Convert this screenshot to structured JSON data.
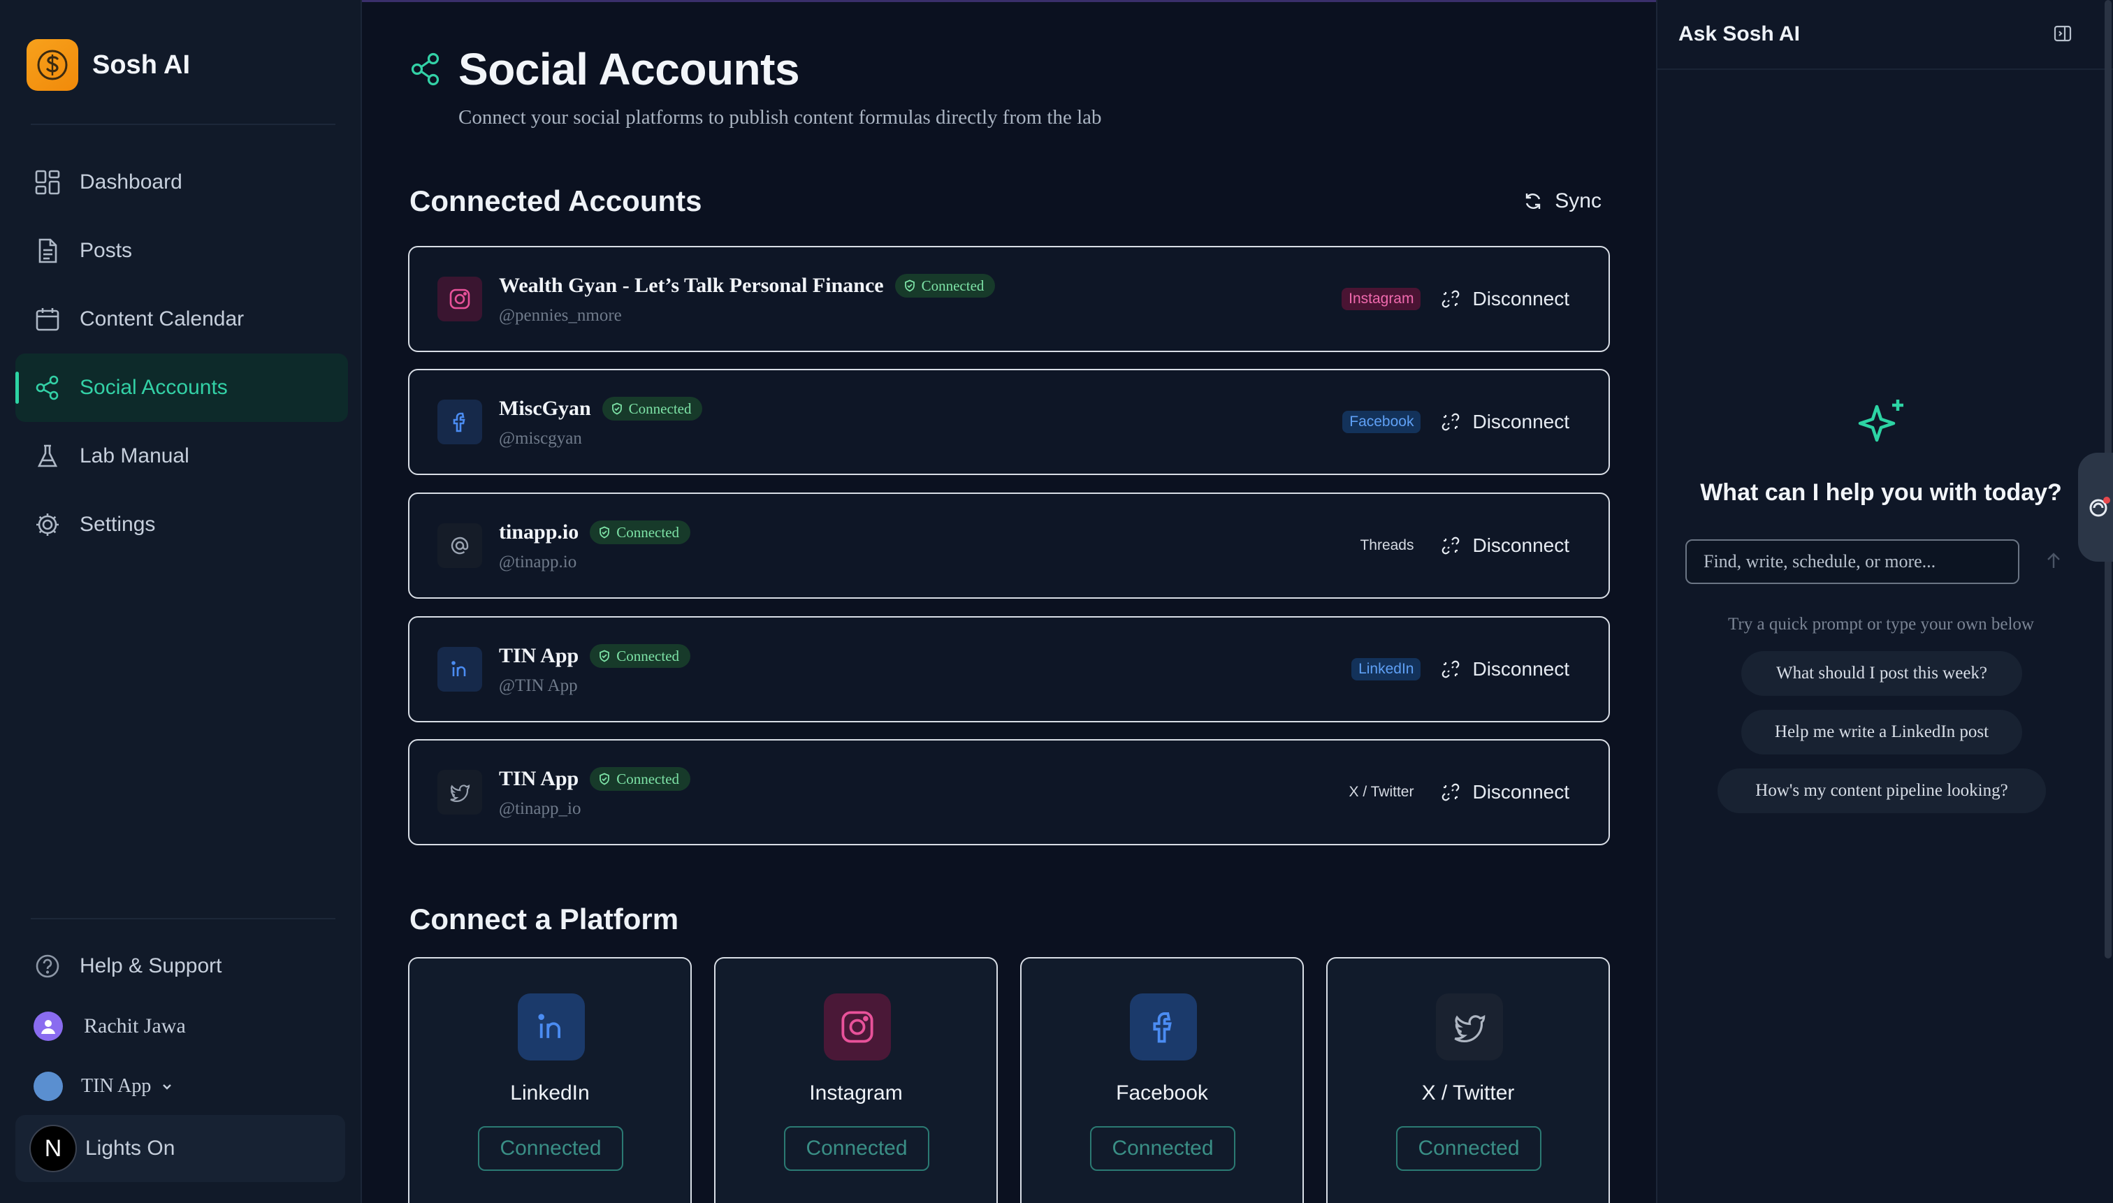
{
  "app": {
    "name": "Sosh AI"
  },
  "sidebar": {
    "items": [
      {
        "label": "Dashboard",
        "icon": "dashboard-icon"
      },
      {
        "label": "Posts",
        "icon": "document-icon"
      },
      {
        "label": "Content Calendar",
        "icon": "calendar-icon"
      },
      {
        "label": "Social Accounts",
        "icon": "share-icon",
        "active": true
      },
      {
        "label": "Lab Manual",
        "icon": "flask-icon"
      },
      {
        "label": "Settings",
        "icon": "gear-icon"
      }
    ],
    "help": "Help & Support",
    "user": "Rachit Jawa",
    "org": "TIN App",
    "lights": "Lights On",
    "n_badge": "N"
  },
  "page": {
    "title": "Social Accounts",
    "subtitle": "Connect your social platforms to publish content formulas directly from the lab"
  },
  "connected": {
    "title": "Connected Accounts",
    "sync_label": "Sync",
    "badge_label": "Connected",
    "disconnect_label": "Disconnect",
    "accounts": [
      {
        "name": "Wealth Gyan - Let’s Talk Personal Finance",
        "handle": "@pennies_nmore",
        "platform": "Instagram",
        "icon": "instagram-icon",
        "color": "#e8529a"
      },
      {
        "name": "MiscGyan",
        "handle": "@miscgyan",
        "platform": "Facebook",
        "icon": "facebook-icon",
        "color": "#3b82f6"
      },
      {
        "name": "tinapp.io",
        "handle": "@tinapp.io",
        "platform": "Threads",
        "icon": "threads-icon",
        "color": "#9aa3b1"
      },
      {
        "name": "TIN App",
        "handle": "@TIN App",
        "platform": "LinkedIn",
        "icon": "linkedin-icon",
        "color": "#3b82f6"
      },
      {
        "name": "TIN App",
        "handle": "@tinapp_io",
        "platform": "X / Twitter",
        "icon": "twitter-icon",
        "color": "#9aa3b1"
      }
    ]
  },
  "connect": {
    "title": "Connect a Platform",
    "platforms": [
      {
        "name": "LinkedIn",
        "button": "Connected",
        "icon": "linkedin-icon"
      },
      {
        "name": "Instagram",
        "button": "Connected",
        "icon": "instagram-icon"
      },
      {
        "name": "Facebook",
        "button": "Connected",
        "icon": "facebook-icon"
      },
      {
        "name": "X / Twitter",
        "button": "Connected",
        "icon": "twitter-icon"
      }
    ]
  },
  "assistant": {
    "title": "Ask Sosh AI",
    "question": "What can I help you with today?",
    "placeholder": "Find, write, schedule, or more...",
    "hint": "Try a quick prompt or type your own below",
    "prompts": [
      "What should I post this week?",
      "Help me write a LinkedIn post",
      "How's my content pipeline looking?"
    ]
  },
  "colors": {
    "accent": "#2dd4a4",
    "brand": "#f7a11c",
    "background": "#0b1120"
  }
}
